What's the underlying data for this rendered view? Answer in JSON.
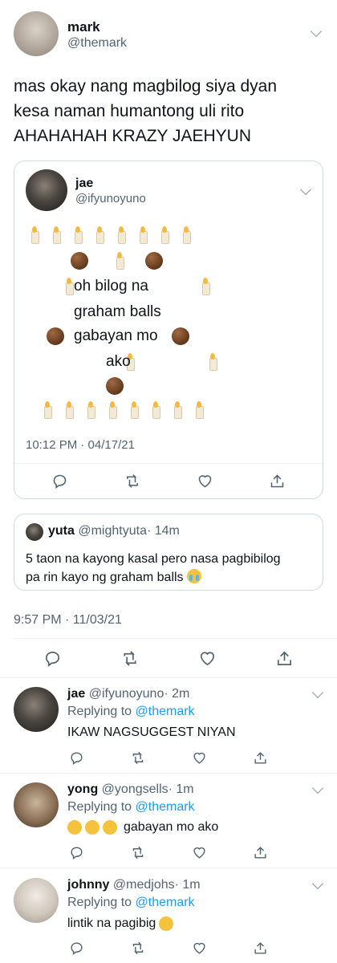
{
  "main_tweet": {
    "name": "mark",
    "handle": "@themark",
    "text_lines": [
      "mas okay nang magbilog siya dyan",
      "kesa naman humantong uli rito",
      "AHAHAHAH KRAZY JAEHYUN"
    ],
    "timestamp": "9:57 PM · 11/03/21"
  },
  "quoted_tweet": {
    "name": "jae",
    "handle": "@ifyunoyuno",
    "poem_line1": "oh bilog na",
    "poem_line2": "graham balls",
    "poem_line3": "gabayan mo",
    "poem_line4": "ako",
    "timestamp": "10:12 PM · 04/17/21"
  },
  "quoted_reply": {
    "name": "yuta",
    "handle": "@mightyuta",
    "time": "· 14m",
    "text_line1": "5 taon na kayong kasal pero nasa pagbibilog",
    "text_line2": "pa rin kayo ng graham balls"
  },
  "replies": [
    {
      "name": "jae",
      "handle": "@ifyunoyuno",
      "time": "· 2m",
      "replying_label": "Replying to",
      "replying_to": "@themark",
      "text": "IKAW NAGSUGGEST NIYAN"
    },
    {
      "name": "yong",
      "handle": "@yongsells",
      "time": "· 1m",
      "replying_label": "Replying to",
      "replying_to": "@themark",
      "text": "gabayan mo ako"
    },
    {
      "name": "johnny",
      "handle": "@medjohs",
      "time": "· 1m",
      "replying_label": "Replying to",
      "replying_to": "@themark",
      "text": "lintik na pagibig"
    }
  ],
  "icons": [
    "reply-icon",
    "retweet-icon",
    "like-icon",
    "share-icon",
    "chevron-down-icon",
    "candle-emoji",
    "cookie-emoji",
    "crying-emoji"
  ],
  "colors": {
    "link": "#1d9bf0",
    "muted": "#536471",
    "border": "#cfd9de"
  }
}
